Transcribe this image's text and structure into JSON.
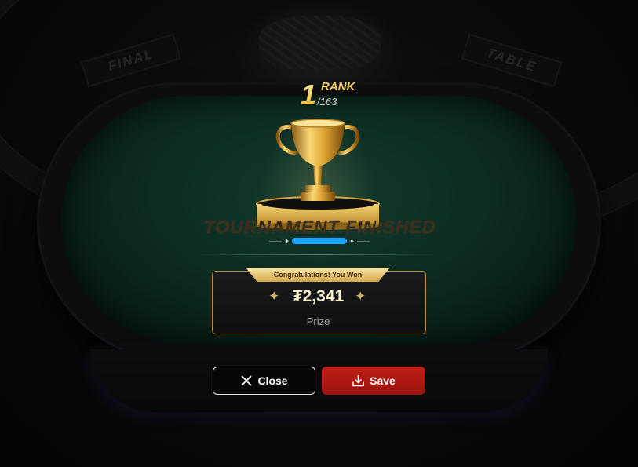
{
  "background": {
    "banner_left": "FINAL",
    "banner_right": "TABLE",
    "table_felt_color": "#154536"
  },
  "result": {
    "rank_number": "1",
    "rank_label": "RANK",
    "rank_total": "/163",
    "headline": "TOURNAMENT FINISHED",
    "player_name_redacted": true,
    "player_name_color": "#1aa3ff"
  },
  "prize": {
    "banner": "Congratulations! You Won",
    "amount": "₮2,341",
    "label": "Prize",
    "accent_color": "#d4a647"
  },
  "actions": {
    "close_label": "Close",
    "close_icon": "close-icon",
    "save_label": "Save",
    "save_icon": "download-icon",
    "save_color": "#c21e16"
  }
}
